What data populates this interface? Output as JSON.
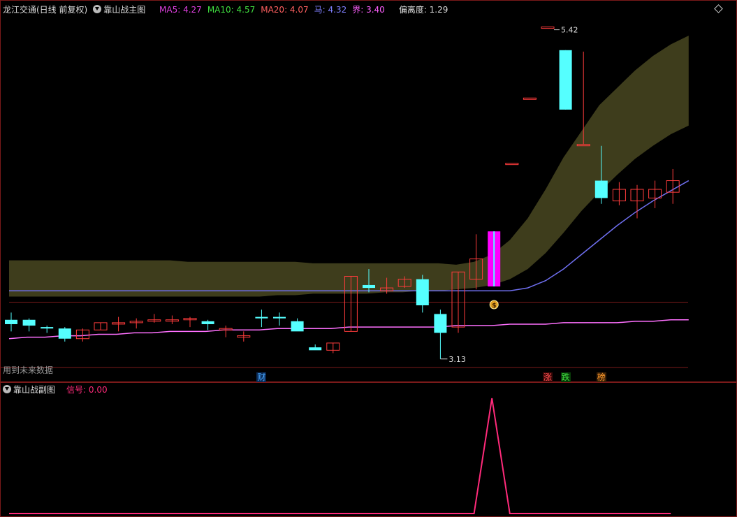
{
  "main": {
    "title": "龙江交通(日线 前复权)",
    "indicator_name": "靠山战主图",
    "legend": [
      {
        "label": "MA5: 4.27",
        "color": "#e040e0"
      },
      {
        "label": "MA10: 4.57",
        "color": "#40e040"
      },
      {
        "label": "MA20: 4.07",
        "color": "#ff6060"
      },
      {
        "label": "马: 4.32",
        "color": "#8080ff"
      },
      {
        "label": "界: 3.40",
        "color": "#ff60ff"
      },
      {
        "label": "偏离度: 1.29",
        "color": "#dddddd"
      }
    ],
    "notice": "用到未来数据",
    "high_label": "5.42",
    "low_label": "3.13"
  },
  "markers": [
    {
      "text": "财",
      "color": "#4aa8ff",
      "bg": "#0a2a55"
    },
    {
      "text": "涨",
      "color": "#ff5050",
      "bg": "#3a0808"
    },
    {
      "text": "跌",
      "color": "#40e040",
      "bg": "#083a08"
    },
    {
      "text": "榜",
      "color": "#ff9a2a",
      "bg": "#3a2008"
    }
  ],
  "sub": {
    "indicator_name": "靠山战副图",
    "signal_label": "信号: 0.00"
  },
  "colors": {
    "up": "#ff3c3c",
    "down": "#55ffff",
    "band": "#3e3d1c",
    "ma_horse": "#6f6ff0",
    "ma_line": "#ff70ff",
    "signal": "#ff2a7a",
    "frame": "#7a1a1a"
  },
  "chart_data": {
    "type": "candlestick",
    "candles": [
      {
        "o": 3.4,
        "h": 3.45,
        "l": 3.32,
        "c": 3.37
      },
      {
        "o": 3.4,
        "h": 3.41,
        "l": 3.32,
        "c": 3.36
      },
      {
        "o": 3.35,
        "h": 3.36,
        "l": 3.31,
        "c": 3.34
      },
      {
        "o": 3.34,
        "h": 3.35,
        "l": 3.25,
        "c": 3.27
      },
      {
        "o": 3.27,
        "h": 3.34,
        "l": 3.25,
        "c": 3.33
      },
      {
        "o": 3.33,
        "h": 3.38,
        "l": 3.33,
        "c": 3.38
      },
      {
        "o": 3.38,
        "h": 3.42,
        "l": 3.32,
        "c": 3.38
      },
      {
        "o": 3.38,
        "h": 3.41,
        "l": 3.34,
        "c": 3.39
      },
      {
        "o": 3.39,
        "h": 3.44,
        "l": 3.38,
        "c": 3.4
      },
      {
        "o": 3.4,
        "h": 3.43,
        "l": 3.37,
        "c": 3.4
      },
      {
        "o": 3.4,
        "h": 3.42,
        "l": 3.35,
        "c": 3.41
      },
      {
        "o": 3.39,
        "h": 3.4,
        "l": 3.33,
        "c": 3.37
      },
      {
        "o": 3.33,
        "h": 3.36,
        "l": 3.28,
        "c": 3.34
      },
      {
        "o": 3.29,
        "h": 3.32,
        "l": 3.25,
        "c": 3.29
      },
      {
        "o": 3.42,
        "h": 3.47,
        "l": 3.35,
        "c": 3.41
      },
      {
        "o": 3.42,
        "h": 3.45,
        "l": 3.36,
        "c": 3.41
      },
      {
        "o": 3.39,
        "h": 3.41,
        "l": 3.33,
        "c": 3.32
      },
      {
        "o": 3.21,
        "h": 3.23,
        "l": 3.2,
        "c": 3.19
      },
      {
        "o": 3.19,
        "h": 3.24,
        "l": 3.17,
        "c": 3.24
      },
      {
        "o": 3.32,
        "h": 3.7,
        "l": 3.32,
        "c": 3.7
      },
      {
        "o": 3.64,
        "h": 3.75,
        "l": 3.59,
        "c": 3.62
      },
      {
        "o": 3.6,
        "h": 3.69,
        "l": 3.58,
        "c": 3.62
      },
      {
        "o": 3.63,
        "h": 3.7,
        "l": 3.62,
        "c": 3.68
      },
      {
        "o": 3.68,
        "h": 3.71,
        "l": 3.45,
        "c": 3.5
      },
      {
        "o": 3.44,
        "h": 3.47,
        "l": 3.13,
        "c": 3.31
      },
      {
        "o": 3.35,
        "h": 3.73,
        "l": 3.31,
        "c": 3.73
      },
      {
        "o": 3.68,
        "h": 3.99,
        "l": 3.61,
        "c": 3.82
      },
      {
        "o": 4.01,
        "h": 4.01,
        "l": 3.63,
        "c": 3.63
      },
      {
        "o": 4.48,
        "h": 4.48,
        "l": 4.48,
        "c": 4.48
      },
      {
        "o": 4.93,
        "h": 4.93,
        "l": 4.93,
        "c": 4.93
      },
      {
        "o": 5.42,
        "h": 5.42,
        "l": 5.42,
        "c": 5.42
      },
      {
        "o": 5.26,
        "h": 5.26,
        "l": 4.85,
        "c": 4.85
      },
      {
        "o": 4.61,
        "h": 5.25,
        "l": 4.61,
        "c": 4.61
      },
      {
        "o": 4.36,
        "h": 4.6,
        "l": 4.2,
        "c": 4.24
      },
      {
        "o": 4.22,
        "h": 4.35,
        "l": 4.19,
        "c": 4.3
      },
      {
        "o": 4.22,
        "h": 4.33,
        "l": 4.1,
        "c": 4.3
      },
      {
        "o": 4.24,
        "h": 4.36,
        "l": 4.17,
        "c": 4.3
      },
      {
        "o": 4.28,
        "h": 4.44,
        "l": 4.2,
        "c": 4.36
      }
    ],
    "special_candle_index": 27,
    "band_upper": [
      3.81,
      3.81,
      3.81,
      3.81,
      3.81,
      3.81,
      3.81,
      3.81,
      3.81,
      3.81,
      3.8,
      3.8,
      3.8,
      3.8,
      3.8,
      3.8,
      3.8,
      3.79,
      3.79,
      3.79,
      3.79,
      3.79,
      3.79,
      3.79,
      3.79,
      3.78,
      3.8,
      3.85,
      3.95,
      4.1,
      4.3,
      4.52,
      4.7,
      4.88,
      5.0,
      5.12,
      5.22,
      5.3,
      5.36
    ],
    "band_lower": [
      3.56,
      3.56,
      3.56,
      3.56,
      3.56,
      3.56,
      3.56,
      3.56,
      3.56,
      3.56,
      3.56,
      3.56,
      3.56,
      3.56,
      3.56,
      3.57,
      3.57,
      3.58,
      3.58,
      3.58,
      3.58,
      3.59,
      3.59,
      3.6,
      3.6,
      3.61,
      3.62,
      3.64,
      3.68,
      3.75,
      3.86,
      4.0,
      4.15,
      4.28,
      4.4,
      4.51,
      4.6,
      4.68,
      4.74
    ],
    "horse_line": [
      3.6,
      3.6,
      3.6,
      3.6,
      3.6,
      3.6,
      3.6,
      3.6,
      3.6,
      3.6,
      3.6,
      3.6,
      3.6,
      3.6,
      3.6,
      3.6,
      3.6,
      3.6,
      3.6,
      3.6,
      3.6,
      3.6,
      3.6,
      3.6,
      3.6,
      3.6,
      3.6,
      3.6,
      3.6,
      3.62,
      3.67,
      3.75,
      3.85,
      3.95,
      4.05,
      4.14,
      4.22,
      4.29,
      4.36
    ],
    "boundary_line": [
      3.27,
      3.28,
      3.28,
      3.29,
      3.29,
      3.3,
      3.3,
      3.31,
      3.31,
      3.32,
      3.32,
      3.32,
      3.33,
      3.33,
      3.33,
      3.34,
      3.34,
      3.34,
      3.34,
      3.35,
      3.35,
      3.35,
      3.35,
      3.35,
      3.35,
      3.36,
      3.36,
      3.36,
      3.37,
      3.37,
      3.37,
      3.38,
      3.38,
      3.38,
      3.38,
      3.39,
      3.39,
      3.4,
      3.4
    ],
    "reference_line": 3.56,
    "signal": [
      0,
      0,
      0,
      0,
      0,
      0,
      0,
      0,
      0,
      0,
      0,
      0,
      0,
      0,
      0,
      0,
      0,
      0,
      0,
      0,
      0,
      0,
      0,
      0,
      0,
      0,
      0,
      1,
      0,
      0,
      0,
      0,
      0,
      0,
      0,
      0,
      0,
      0
    ],
    "marker_positions": [
      14,
      30,
      31,
      33
    ]
  }
}
